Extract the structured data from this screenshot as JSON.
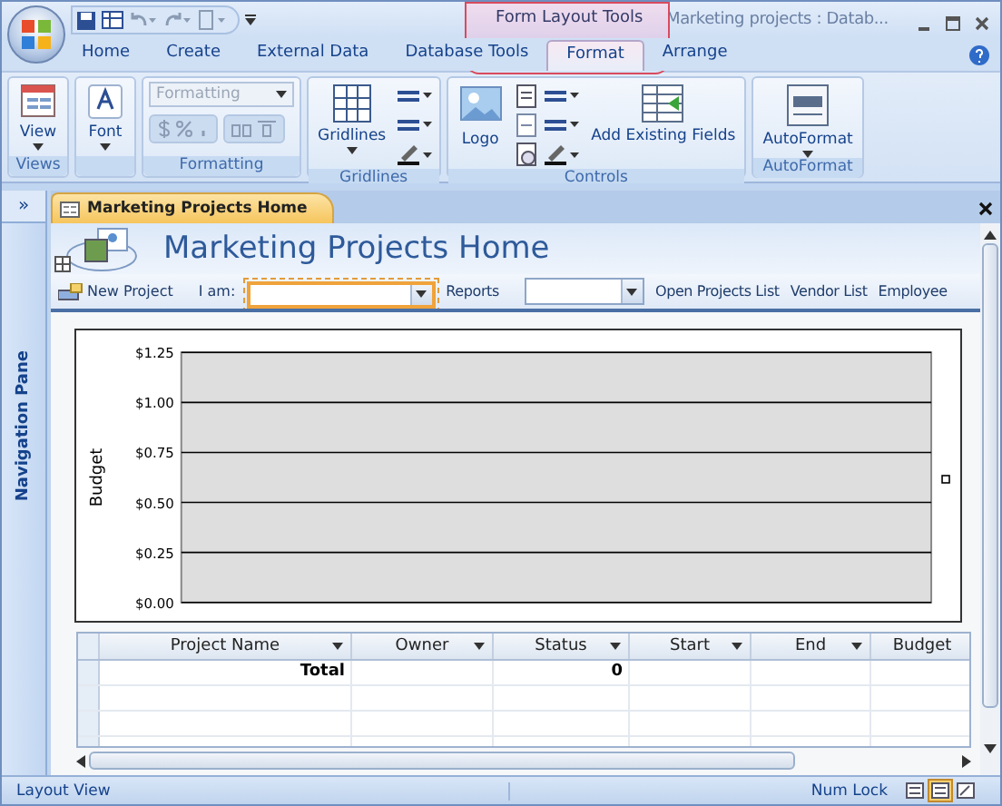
{
  "title_bar": {
    "contextual_group": "Form Layout Tools",
    "title": "Marketing projects : Datab..."
  },
  "ribbon_tabs": [
    {
      "label": "Home",
      "selected": false
    },
    {
      "label": "Create",
      "selected": false
    },
    {
      "label": "External Data",
      "selected": false
    },
    {
      "label": "Database Tools",
      "selected": false
    },
    {
      "label": "Format",
      "selected": true
    },
    {
      "label": "Arrange",
      "selected": false
    }
  ],
  "ribbon_groups": [
    {
      "kind": "views",
      "label": "Views",
      "button": "View"
    },
    {
      "kind": "font",
      "button": "Font"
    },
    {
      "kind": "formatting",
      "label": "Formatting",
      "combo": "Formatting",
      "disabled": true
    },
    {
      "kind": "gridlines",
      "label": "Gridlines",
      "button": "Gridlines"
    },
    {
      "kind": "controls",
      "label": "Controls",
      "button": "Logo",
      "button2": "Add Existing Fields"
    },
    {
      "kind": "autoformat",
      "label": "AutoFormat",
      "button": "AutoFormat"
    }
  ],
  "navigation_pane": {
    "toggle": "»",
    "label": "Navigation Pane"
  },
  "document_tab": {
    "label": "Marketing Projects Home"
  },
  "form": {
    "title": "Marketing Projects Home",
    "toolbar": [
      {
        "kind": "button",
        "label": "New Project"
      },
      {
        "kind": "label",
        "label": "I am:"
      },
      {
        "kind": "combo",
        "focused": true
      },
      {
        "kind": "link",
        "label": "Reports"
      },
      {
        "kind": "combo",
        "focused": false
      },
      {
        "kind": "link",
        "label": "Open Projects List"
      },
      {
        "kind": "link",
        "label": "Vendor List"
      },
      {
        "kind": "link",
        "label": "Employee"
      }
    ],
    "chart": {
      "chart_data": {
        "type": "bar",
        "grid": true,
        "categories": [
          null
        ],
        "values": [
          null
        ],
        "ylabel": "Budget",
        "ylim": [
          0,
          1.25
        ],
        "yticks": [
          {
            "value": 0,
            "label": "$0.00"
          },
          {
            "value": 0.25,
            "label": "$0.25"
          },
          {
            "value": 0.5,
            "label": "$0.50"
          },
          {
            "value": 0.75,
            "label": "$0.75"
          },
          {
            "value": 1,
            "label": "$1.00"
          },
          {
            "value": 1.25,
            "label": "$1.25"
          }
        ]
      }
    },
    "table": {
      "columns": [
        "Project Name",
        "Owner",
        "Status",
        "Start",
        "End",
        "Budget"
      ],
      "rows": [
        {
          "cells": [
            "Total",
            "",
            "0",
            "",
            "",
            ""
          ],
          "bold": true
        }
      ]
    }
  },
  "status_bar": {
    "mode": "Layout View",
    "indicator": "Num Lock",
    "views": [
      {
        "selected": false
      },
      {
        "selected": true
      },
      {
        "selected": false
      }
    ]
  }
}
